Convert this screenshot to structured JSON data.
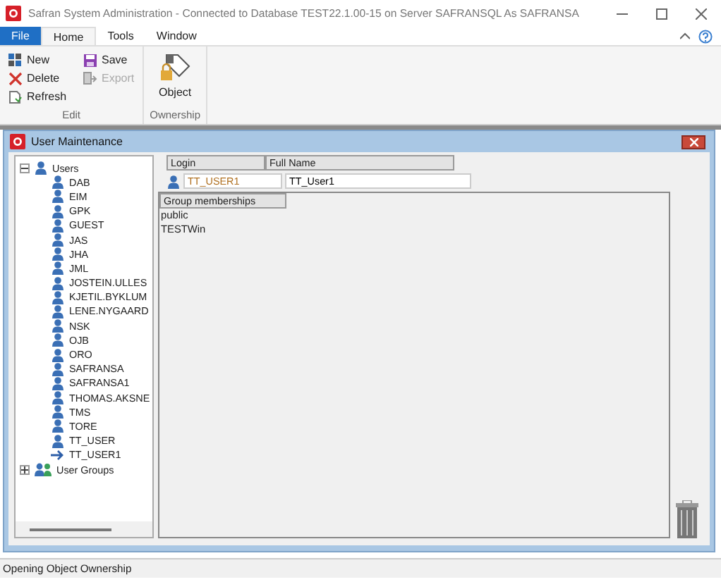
{
  "window": {
    "title": "Safran System Administration - Connected to Database TEST22.1.00-15 on Server SAFRANSQL As SAFRANSA"
  },
  "menu": [
    {
      "label": "File",
      "kind": "file",
      "selected": false
    },
    {
      "label": "Home",
      "kind": "tab",
      "selected": true
    },
    {
      "label": "Tools",
      "kind": "tab",
      "selected": false
    },
    {
      "label": "Window",
      "kind": "tab",
      "selected": false
    }
  ],
  "ribbon": {
    "groups": [
      {
        "label": "Edit",
        "buttons": [
          {
            "label": "New",
            "kind": "new",
            "disabled": false
          },
          {
            "label": "Delete",
            "kind": "delete",
            "disabled": false
          },
          {
            "label": "Refresh",
            "kind": "refresh",
            "disabled": false
          },
          {
            "label": "Save",
            "kind": "save",
            "disabled": false
          },
          {
            "label": "Export",
            "kind": "export",
            "disabled": true
          }
        ]
      },
      {
        "label": "Ownership",
        "buttons": [
          {
            "label": "Object",
            "kind": "object",
            "disabled": false
          }
        ]
      }
    ]
  },
  "child_window": {
    "title": "User Maintenance",
    "tree": [
      {
        "label": "Users",
        "kind": "users",
        "expanded": true,
        "children": [
          {
            "label": "DAB",
            "selected": false
          },
          {
            "label": "EIM",
            "selected": false
          },
          {
            "label": "GPK",
            "selected": false
          },
          {
            "label": "GUEST",
            "selected": false
          },
          {
            "label": "JAS",
            "selected": false
          },
          {
            "label": "JHA",
            "selected": false
          },
          {
            "label": "JML",
            "selected": false
          },
          {
            "label": "JOSTEIN.ULLES",
            "selected": false
          },
          {
            "label": "KJETIL.BYKLUM",
            "selected": false
          },
          {
            "label": "LENE.NYGAARD",
            "selected": false
          },
          {
            "label": "NSK",
            "selected": false
          },
          {
            "label": "OJB",
            "selected": false
          },
          {
            "label": "ORO",
            "selected": false
          },
          {
            "label": "SAFRANSA",
            "selected": false
          },
          {
            "label": "SAFRANSA1",
            "selected": false
          },
          {
            "label": "THOMAS.AKSNE",
            "selected": false
          },
          {
            "label": "TMS",
            "selected": false
          },
          {
            "label": "TORE",
            "selected": false
          },
          {
            "label": "TT_USER",
            "selected": false
          },
          {
            "label": "TT_USER1",
            "selected": true
          }
        ]
      },
      {
        "label": "User Groups",
        "kind": "groups",
        "expanded": false
      }
    ],
    "columns": [
      "Login",
      "Full Name"
    ],
    "login": "TT_USER1",
    "full_name": "TT_User1",
    "groups_header": "Group memberships",
    "groups": [
      "public",
      "TESTWin"
    ]
  },
  "status_bar": "Opening Object Ownership"
}
